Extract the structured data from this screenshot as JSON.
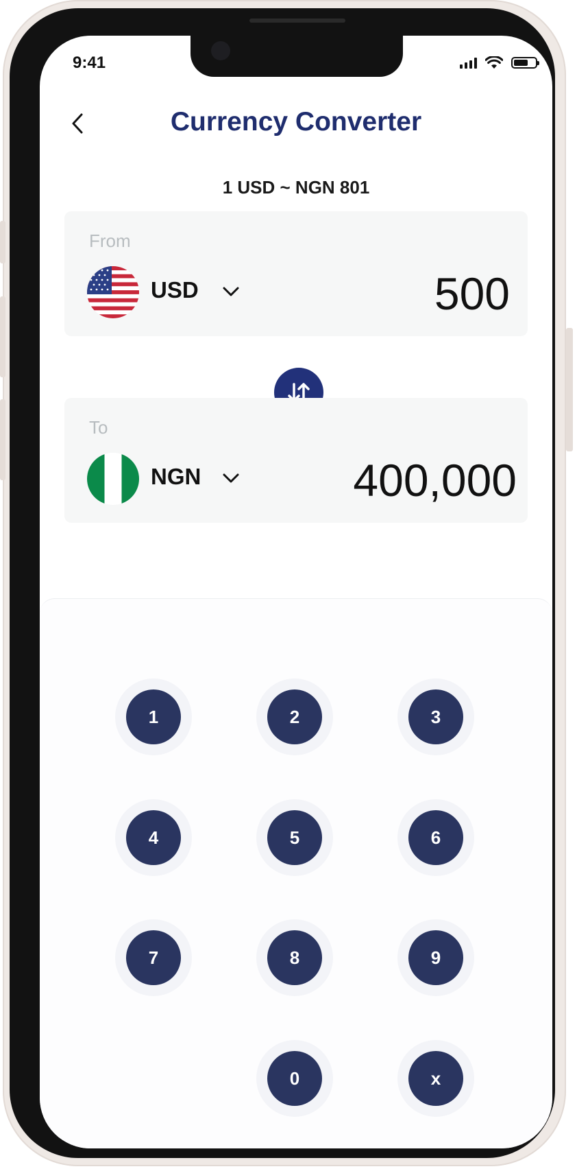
{
  "status_bar": {
    "time": "9:41"
  },
  "header": {
    "title": "Currency Converter"
  },
  "rate_text": "1 USD ~  NGN 801",
  "from": {
    "label": "From",
    "currency": "USD",
    "amount": "500"
  },
  "to": {
    "label": "To",
    "currency": "NGN",
    "amount": "400,000"
  },
  "keypad": {
    "keys": [
      "1",
      "2",
      "3",
      "4",
      "5",
      "6",
      "7",
      "8",
      "9",
      "0",
      "x"
    ]
  },
  "colors": {
    "brand": "#1f2d6e",
    "key": "#2a3560",
    "card": "#f6f7f7"
  }
}
